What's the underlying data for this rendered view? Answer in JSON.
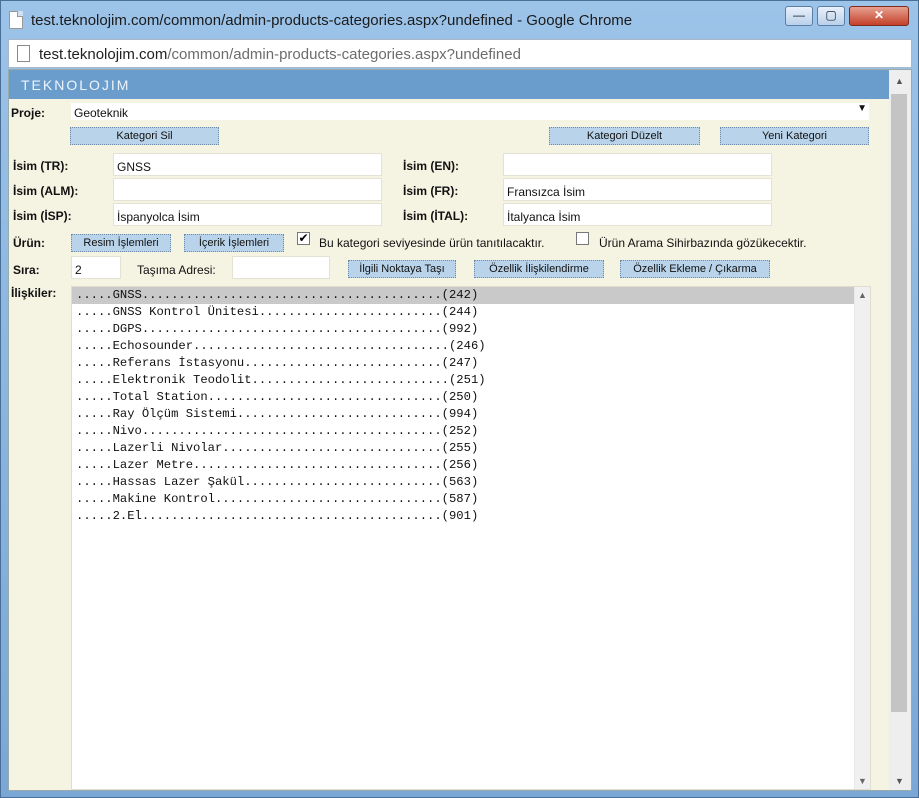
{
  "window": {
    "title": "test.teknolojim.com/common/admin-products-categories.aspx?undefined - Google Chrome",
    "min_glyph": "—",
    "max_glyph": "▢",
    "close_glyph": "✕"
  },
  "address": {
    "host": "test.teknolojim.com",
    "path": "/common/admin-products-categories.aspx?undefined"
  },
  "brand": "TEKNOLOJIM",
  "proje": {
    "label": "Proje:",
    "value": "Geoteknik",
    "arrow": "▼"
  },
  "buttons": {
    "kategori_sil": "Kategori Sil",
    "kategori_duzelt": "Kategori Düzelt",
    "yeni_kategori": "Yeni Kategori",
    "resim": "Resim İşlemleri",
    "icerik": "İçerik İşlemleri",
    "noktaya_tasi": "İlgili Noktaya Taşı",
    "ozellik_iliskilendirme": "Özellik İlişkilendirme",
    "ozellik_ekleme": "Özellik Ekleme / Çıkarma"
  },
  "fields": {
    "isim_tr": {
      "label": "İsim (TR):",
      "value": "GNSS"
    },
    "isim_en": {
      "label": "İsim (EN):",
      "value": ""
    },
    "isim_alm": {
      "label": "İsim (ALM):",
      "value": ""
    },
    "isim_fr": {
      "label": "İsim (FR):",
      "value": "Fransızca İsim"
    },
    "isim_isp": {
      "label": "İsim (İSP):",
      "value": "İspanyolca İsim"
    },
    "isim_ital": {
      "label": "İsim (İTAL):",
      "value": "İtalyanca İsim"
    }
  },
  "urun": {
    "label": "Ürün:",
    "check1": {
      "checked": true,
      "mark": "✔",
      "label": "Bu kategori seviyesinde ürün tanıtılacaktır."
    },
    "check2": {
      "checked": false,
      "mark": "",
      "label": "Ürün Arama Sihirbazında gözükecektir."
    }
  },
  "sira": {
    "label": "Sıra:",
    "value": "2"
  },
  "tasima": {
    "label": "Taşıma Adresi:",
    "value": ""
  },
  "iliskiler": {
    "label": "İlişkiler:",
    "items": [
      ".....GNSS.........................................(242)",
      ".....GNSS Kontrol Ünitesi.........................(244)",
      ".....DGPS.........................................(992)",
      ".....Echosounder...................................(246)",
      ".....Referans İstasyonu...........................(247)",
      ".....Elektronik Teodolit...........................(251)",
      ".....Total Station................................(250)",
      ".....Ray Ölçüm Sistemi............................(994)",
      ".....Nivo.........................................(252)",
      ".....Lazerli Nivolar..............................(255)",
      ".....Lazer Metre..................................(256)",
      ".....Hassas Lazer Şakül...........................(563)",
      ".....Makine Kontrol...............................(587)",
      ".....2.El.........................................(901)"
    ]
  },
  "scroll": {
    "up": "▲",
    "down": "▼"
  }
}
